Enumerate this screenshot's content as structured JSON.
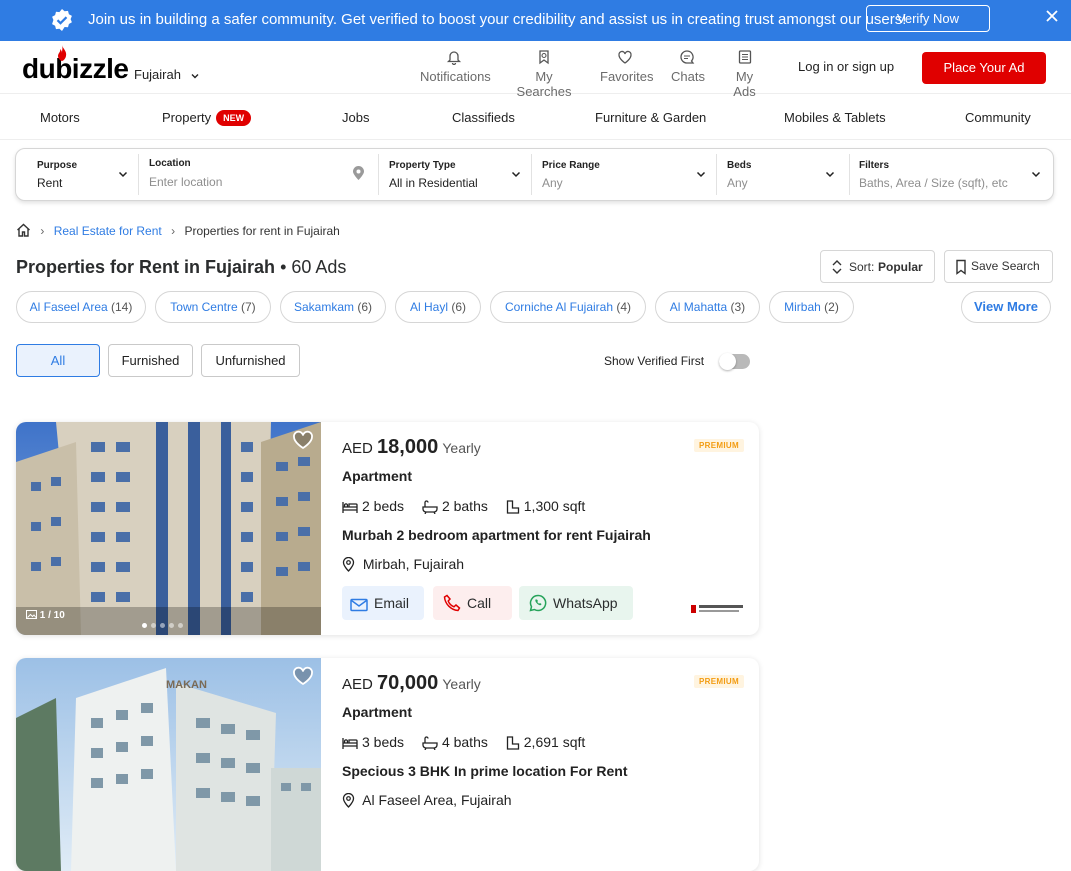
{
  "banner": {
    "text": "Join us in building a safer community. Get verified to boost your credibility and assist us in creating trust amongst our users!",
    "button": "Verify Now"
  },
  "header": {
    "logo": "dubizzle",
    "city": "Fujairah",
    "nav": [
      {
        "label": "Notifications",
        "icon": "bell-icon"
      },
      {
        "label": "My Searches",
        "icon": "search-bookmark-icon"
      },
      {
        "label": "Favorites",
        "icon": "heart-icon"
      },
      {
        "label": "Chats",
        "icon": "chat-icon"
      },
      {
        "label": "My Ads",
        "icon": "list-icon"
      }
    ],
    "login": "Log in or sign up",
    "place_ad": "Place Your Ad"
  },
  "categories": [
    "Motors",
    "Property",
    "Jobs",
    "Classifieds",
    "Furniture & Garden",
    "Mobiles & Tablets",
    "Community"
  ],
  "new_badge": "NEW",
  "search": {
    "purpose_label": "Purpose",
    "purpose_value": "Rent",
    "location_label": "Location",
    "location_placeholder": "Enter location",
    "type_label": "Property Type",
    "type_value": "All in Residential",
    "price_label": "Price Range",
    "price_value": "Any",
    "beds_label": "Beds",
    "beds_value": "Any",
    "filters_label": "Filters",
    "filters_value": "Baths, Area / Size (sqft), etc"
  },
  "breadcrumb": {
    "link": "Real Estate for Rent",
    "current": "Properties for rent in Fujairah"
  },
  "page_title": "Properties for Rent in Fujairah",
  "page_count": "• 60 Ads",
  "sort": {
    "label": "Sort:",
    "value": "Popular"
  },
  "save_search": "Save Search",
  "areas": [
    {
      "name": "Al Faseel Area",
      "count": "(14)"
    },
    {
      "name": "Town Centre",
      "count": "(7)"
    },
    {
      "name": "Sakamkam",
      "count": "(6)"
    },
    {
      "name": "Al Hayl",
      "count": "(6)"
    },
    {
      "name": "Corniche Al Fujairah",
      "count": "(4)"
    },
    {
      "name": "Al Mahatta",
      "count": "(3)"
    },
    {
      "name": "Mirbah",
      "count": "(2)"
    }
  ],
  "view_more": "View More",
  "furnish_filters": [
    "All",
    "Furnished",
    "Unfurnished"
  ],
  "verified_first": "Show Verified First",
  "listings": [
    {
      "currency": "AED",
      "price": "18,000",
      "period": "Yearly",
      "badge": "PREMIUM",
      "type": "Apartment",
      "beds": "2 beds",
      "baths": "2 baths",
      "area": "1,300 sqft",
      "title": "Murbah 2 bedroom apartment for rent Fujairah",
      "location": "Mirbah, Fujairah",
      "photo_counter": "1 / 10",
      "actions": [
        "Email",
        "Call",
        "WhatsApp"
      ]
    },
    {
      "currency": "AED",
      "price": "70,000",
      "period": "Yearly",
      "badge": "PREMIUM",
      "type": "Apartment",
      "beds": "3 beds",
      "baths": "4 baths",
      "area": "2,691 sqft",
      "title": "Specious 3 BHK In prime location For Rent",
      "location": "Al Faseel Area, Fujairah"
    }
  ],
  "colors": {
    "brand_red": "#e00000",
    "link_blue": "#2f7ce3",
    "banner_blue": "#2f7ce3",
    "whatsapp_green": "#25d366"
  }
}
